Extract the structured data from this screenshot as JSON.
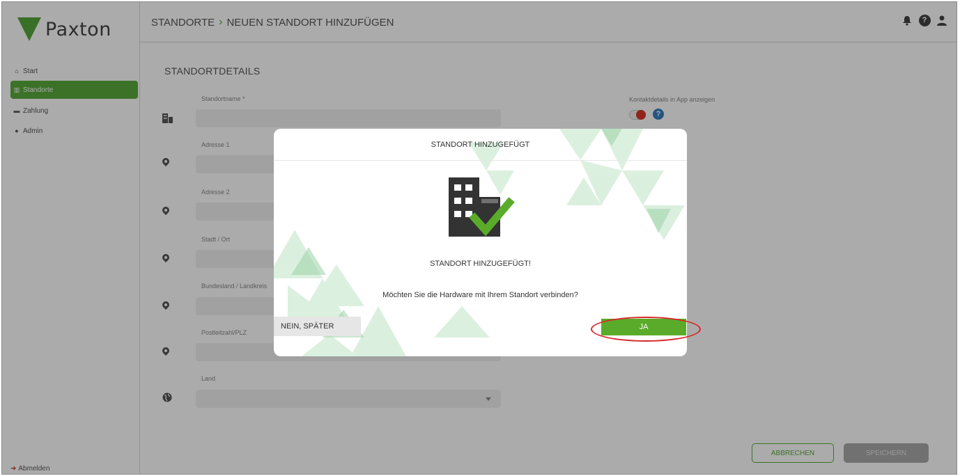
{
  "brand": {
    "name": "Paxton"
  },
  "sidebar": {
    "items": [
      {
        "label": "Start",
        "icon": "home-icon"
      },
      {
        "label": "Standorte",
        "icon": "building-icon",
        "active": true
      },
      {
        "label": "Zahlung",
        "icon": "card-icon"
      },
      {
        "label": "Admin",
        "icon": "user-icon"
      }
    ],
    "logout_label": "Abmelden"
  },
  "header": {
    "breadcrumb": [
      "STANDORTE",
      "NEUEN STANDORT HINZUFÜGEN"
    ],
    "icons": [
      "bell-icon",
      "help-icon",
      "user-icon"
    ]
  },
  "form": {
    "section_title": "STANDORTDETAILS",
    "fields": [
      {
        "label": "Standortname *",
        "value": "",
        "icon": "building-icon"
      },
      {
        "label": "Adresse 1",
        "value": "",
        "icon": "pin-icon"
      },
      {
        "label": "Adresse 2",
        "value": "",
        "icon": "pin-icon"
      },
      {
        "label": "Stadt / Ort",
        "value": "",
        "icon": "pin-icon"
      },
      {
        "label": "Bundesland / Landkreis",
        "value": "",
        "icon": "pin-icon"
      },
      {
        "label": "Postleitzahl/PLZ",
        "value": "",
        "icon": "pin-icon"
      },
      {
        "label": "Land",
        "value": "",
        "icon": "globe-icon"
      }
    ],
    "contact_label": "Kontaktdetails in App anzeigen",
    "cancel_label": "ABBRECHEN",
    "save_label": "SPEICHERN"
  },
  "modal": {
    "title": "STANDORT HINZUGEFÜGT",
    "heading": "STANDORT HINZUGEFÜGT!",
    "question": "Möchten Sie die Hardware mit Ihrem Standort verbinden?",
    "later_label": "NEIN, SPÄTER",
    "yes_label": "JA"
  },
  "colors": {
    "accent": "#5aab3b",
    "highlight": "#d82727",
    "help": "#3a7ec0"
  }
}
